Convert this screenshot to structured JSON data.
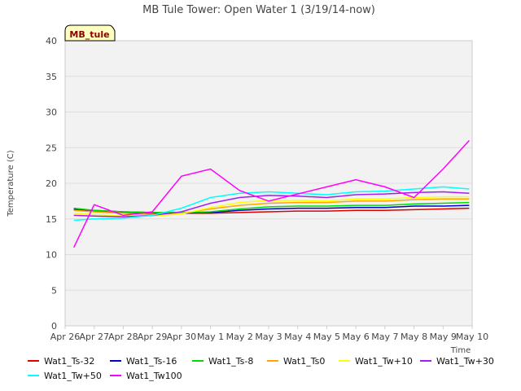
{
  "chart_data": {
    "type": "line",
    "title": "MB Tule Tower: Open Water 1 (3/19/14-now)",
    "ylabel": "Temperature (C)",
    "xlabel": "Time",
    "badge": "MB_tule",
    "ylim": [
      0,
      40
    ],
    "xlim": [
      0,
      14
    ],
    "y_ticks": [
      "0",
      "5",
      "10",
      "15",
      "20",
      "25",
      "30",
      "35",
      "40"
    ],
    "x_tick_labels": [
      "Apr 26",
      "Apr 27",
      "Apr 28",
      "Apr 29",
      "Apr 30",
      "May 1",
      "May 2",
      "May 3",
      "May 4",
      "May 5",
      "May 6",
      "May 7",
      "May 8",
      "May 9",
      "May 10"
    ],
    "grid": true,
    "legend_position": "bottom",
    "x_values_days_from_apr26": [
      0.3,
      1,
      2,
      3,
      4,
      5,
      6,
      7,
      8,
      9,
      10,
      11,
      12,
      13,
      13.9
    ],
    "series": [
      {
        "name": "Wat1_Ts-32",
        "color": "#e00000",
        "values": [
          16.3,
          16.1,
          15.9,
          15.8,
          15.8,
          15.8,
          15.9,
          16.0,
          16.1,
          16.1,
          16.2,
          16.2,
          16.3,
          16.4,
          16.5
        ]
      },
      {
        "name": "Wat1_Ts-16",
        "color": "#0000cc",
        "values": [
          16.4,
          16.2,
          16.0,
          15.9,
          15.8,
          15.9,
          16.2,
          16.4,
          16.5,
          16.5,
          16.6,
          16.6,
          16.8,
          16.8,
          16.9
        ]
      },
      {
        "name": "Wat1_Ts-8",
        "color": "#00dd00",
        "values": [
          16.5,
          16.2,
          16.0,
          15.9,
          15.9,
          16.0,
          16.4,
          16.7,
          16.8,
          16.8,
          16.9,
          16.9,
          17.1,
          17.2,
          17.3
        ]
      },
      {
        "name": "Wat1_Ts0",
        "color": "#ffa500",
        "values": [
          16.2,
          16.0,
          15.8,
          15.6,
          15.8,
          16.4,
          16.9,
          17.2,
          17.3,
          17.3,
          17.5,
          17.5,
          17.7,
          17.8,
          17.8
        ]
      },
      {
        "name": "Wat1_Tw+10",
        "color": "#ffff00",
        "values": [
          15.8,
          15.6,
          15.4,
          15.4,
          15.7,
          16.6,
          17.3,
          17.6,
          17.6,
          17.5,
          17.8,
          17.8,
          18.0,
          18.1,
          18.1
        ]
      },
      {
        "name": "Wat1_Tw+30",
        "color": "#a020f0",
        "values": [
          15.5,
          15.4,
          15.3,
          15.5,
          16.0,
          17.2,
          18.0,
          18.3,
          18.2,
          18.0,
          18.4,
          18.5,
          18.7,
          18.8,
          18.6
        ]
      },
      {
        "name": "Wat1_Tw+50",
        "color": "#00ffff",
        "values": [
          14.8,
          15.0,
          15.1,
          15.5,
          16.5,
          18.0,
          18.6,
          18.8,
          18.6,
          18.4,
          18.8,
          18.9,
          19.2,
          19.5,
          19.2
        ]
      },
      {
        "name": "Wat1_Tw100",
        "color": "#ff00ff",
        "values": [
          11.0,
          17.0,
          15.5,
          16.0,
          21.0,
          22.0,
          19.0,
          17.5,
          18.5,
          19.5,
          20.5,
          19.5,
          18.0,
          22.0,
          26.0
        ]
      }
    ]
  }
}
